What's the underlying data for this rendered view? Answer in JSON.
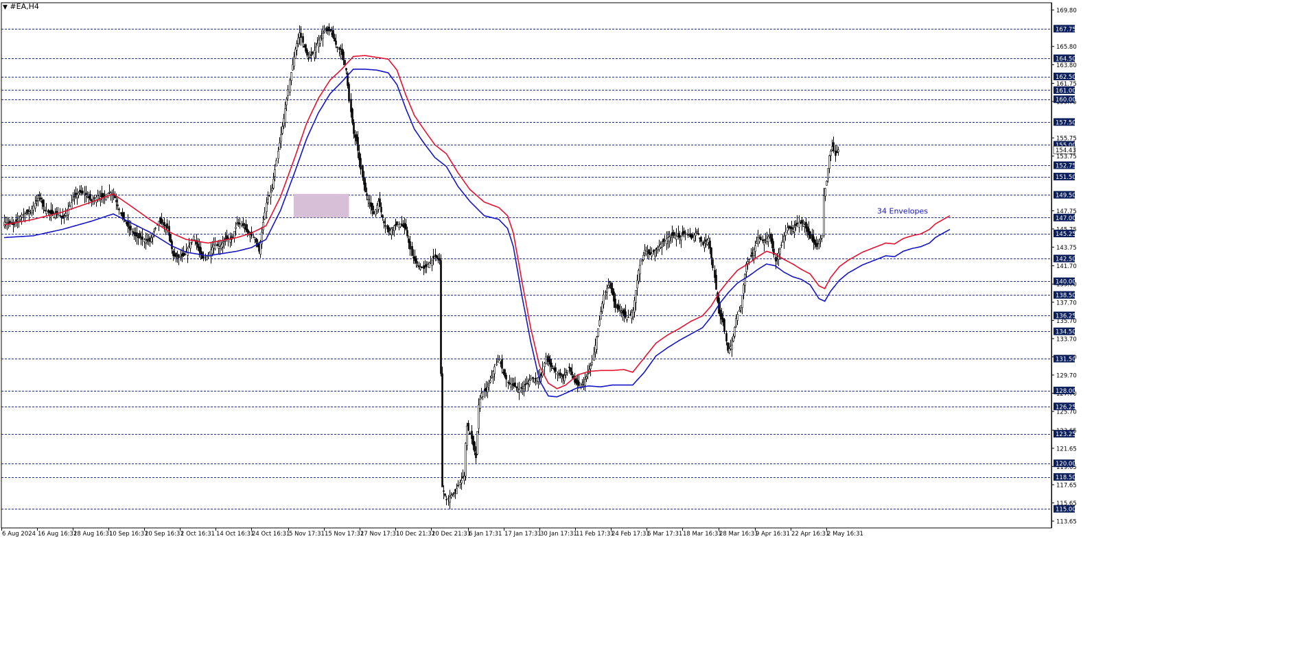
{
  "symbol_title": "#EA,H4",
  "chart_data": {
    "type": "candlestick",
    "symbol": "#EA",
    "timeframe": "H4",
    "indicator_label": "34 Envelopes",
    "ylim": [
      112.9,
      170.6
    ],
    "price_scale_ticks": [
      169.8,
      165.8,
      163.8,
      161.75,
      159.75,
      155.75,
      153.75,
      147.75,
      145.75,
      143.75,
      141.7,
      139.7,
      137.7,
      135.7,
      133.7,
      131.7,
      129.7,
      127.7,
      125.7,
      123.65,
      121.65,
      119.65,
      117.65,
      115.65,
      113.65
    ],
    "x_tick_labels": [
      "6 Aug 2024",
      "16 Aug 16:31",
      "28 Aug 16:31",
      "10 Sep 16:31",
      "20 Sep 16:31",
      "2 Oct 16:31",
      "14 Oct 16:31",
      "24 Oct 16:31",
      "5 Nov 17:31",
      "15 Nov 17:31",
      "27 Nov 17:31",
      "10 Dec 21:31",
      "20 Dec 21:31",
      "6 Jan 17:31",
      "17 Jan 17:31",
      "30 Jan 17:31",
      "11 Feb 17:31",
      "24 Feb 17:31",
      "6 Mar 17:31",
      "18 Mar 16:31",
      "28 Mar 16:31",
      "9 Apr 16:31",
      "22 Apr 16:31",
      "2 May 16:31"
    ],
    "horizontal_levels": [
      "167.75",
      "164.50",
      "162.50",
      "161.00",
      "160.00",
      "157.50",
      "155.00",
      "152.75",
      "151.50",
      "149.50",
      "147.00",
      "145.25",
      "142.50",
      "140.00",
      "138.50",
      "136.25",
      "134.50",
      "131.50",
      "128.00",
      "126.25",
      "123.25",
      "120.00",
      "118.50",
      "115.00"
    ],
    "current_price": "154.43",
    "zone": {
      "from_bar": 199,
      "to_bar": 237,
      "y_low": 147.0,
      "y_high": 149.6
    },
    "close_path": [
      [
        0,
        146.5
      ],
      [
        6,
        146.2
      ],
      [
        12,
        147.3
      ],
      [
        18,
        147.7
      ],
      [
        24,
        149.4
      ],
      [
        28,
        147.8
      ],
      [
        32,
        147.4
      ],
      [
        36,
        147.5
      ],
      [
        40,
        146.9
      ],
      [
        44,
        148.0
      ],
      [
        48,
        149.3
      ],
      [
        52,
        149.8
      ],
      [
        56,
        149.5
      ],
      [
        60,
        148.8
      ],
      [
        64,
        149.4
      ],
      [
        68,
        149.2
      ],
      [
        72,
        149.8
      ],
      [
        75,
        149.6
      ],
      [
        80,
        147.4
      ],
      [
        85,
        146.0
      ],
      [
        90,
        145.0
      ],
      [
        95,
        144.6
      ],
      [
        100,
        144.4
      ],
      [
        106,
        146.6
      ],
      [
        112,
        145.8
      ],
      [
        116,
        142.8
      ],
      [
        120,
        142.6
      ],
      [
        124,
        142.9
      ],
      [
        130,
        144.9
      ],
      [
        136,
        142.5
      ],
      [
        140,
        142.9
      ],
      [
        144,
        144.0
      ],
      [
        148,
        143.8
      ],
      [
        152,
        144.6
      ],
      [
        156,
        144.6
      ],
      [
        160,
        146.4
      ],
      [
        164,
        146.1
      ],
      [
        168,
        145.2
      ],
      [
        172,
        144.8
      ],
      [
        175,
        143.3
      ],
      [
        180,
        148.6
      ],
      [
        184,
        150.2
      ],
      [
        188,
        154.3
      ],
      [
        192,
        157.9
      ],
      [
        196,
        162.1
      ],
      [
        200,
        165.5
      ],
      [
        203,
        167.3
      ],
      [
        206,
        165.7
      ],
      [
        209,
        164.4
      ],
      [
        212,
        165.0
      ],
      [
        216,
        166.5
      ],
      [
        220,
        167.5
      ],
      [
        224,
        167.5
      ],
      [
        228,
        166.0
      ],
      [
        232,
        164.9
      ],
      [
        235,
        163.2
      ],
      [
        237,
        159.8
      ],
      [
        240,
        156.2
      ],
      [
        242,
        155.4
      ],
      [
        245,
        152.3
      ],
      [
        248,
        149.8
      ],
      [
        251,
        148.6
      ],
      [
        254,
        147.4
      ],
      [
        257,
        148.8
      ],
      [
        261,
        146.4
      ],
      [
        264,
        145.4
      ],
      [
        268,
        146.1
      ],
      [
        272,
        146.3
      ],
      [
        276,
        145.7
      ],
      [
        280,
        142.8
      ],
      [
        284,
        141.7
      ],
      [
        288,
        141.4
      ],
      [
        292,
        142.0
      ],
      [
        296,
        142.7
      ],
      [
        299,
        142.3
      ],
      [
        301,
        117.4
      ],
      [
        304,
        116.0
      ],
      [
        307,
        116.5
      ],
      [
        310,
        116.9
      ],
      [
        313,
        117.9
      ],
      [
        316,
        118.6
      ],
      [
        317,
        122.2
      ],
      [
        318,
        124.1
      ],
      [
        321,
        122.7
      ],
      [
        324,
        120.6
      ],
      [
        326,
        126.4
      ],
      [
        328,
        127.7
      ],
      [
        331,
        128.0
      ],
      [
        334,
        129.1
      ],
      [
        337,
        130.6
      ],
      [
        340,
        131.5
      ],
      [
        343,
        129.9
      ],
      [
        346,
        128.9
      ],
      [
        350,
        128.5
      ],
      [
        354,
        128.1
      ],
      [
        358,
        128.6
      ],
      [
        362,
        129.3
      ],
      [
        365,
        129.3
      ],
      [
        369,
        129.6
      ],
      [
        372,
        131.7
      ],
      [
        376,
        130.6
      ],
      [
        380,
        129.9
      ],
      [
        384,
        129.4
      ],
      [
        388,
        130.5
      ],
      [
        392,
        128.9
      ],
      [
        396,
        128.4
      ],
      [
        400,
        129.5
      ],
      [
        404,
        131.1
      ],
      [
        408,
        134.8
      ],
      [
        412,
        138.5
      ],
      [
        416,
        139.9
      ],
      [
        420,
        137.1
      ],
      [
        424,
        136.7
      ],
      [
        428,
        135.8
      ],
      [
        432,
        136.8
      ],
      [
        436,
        141.2
      ],
      [
        440,
        143.4
      ],
      [
        444,
        142.9
      ],
      [
        448,
        143.5
      ],
      [
        452,
        144.2
      ],
      [
        456,
        144.8
      ],
      [
        460,
        145.1
      ],
      [
        464,
        144.8
      ],
      [
        468,
        145.4
      ],
      [
        472,
        144.7
      ],
      [
        476,
        145.5
      ],
      [
        480,
        144.0
      ],
      [
        484,
        144.7
      ],
      [
        488,
        140.4
      ],
      [
        491,
        136.5
      ],
      [
        494,
        135.5
      ],
      [
        497,
        132.4
      ],
      [
        500,
        133.0
      ],
      [
        503,
        135.9
      ],
      [
        506,
        137.3
      ],
      [
        510,
        141.9
      ],
      [
        514,
        143.0
      ],
      [
        518,
        144.8
      ],
      [
        522,
        144.3
      ],
      [
        526,
        145.1
      ],
      [
        530,
        142.2
      ],
      [
        534,
        144.0
      ],
      [
        538,
        145.9
      ],
      [
        542,
        145.7
      ],
      [
        546,
        146.5
      ],
      [
        550,
        146.2
      ],
      [
        554,
        144.7
      ],
      [
        558,
        143.8
      ],
      [
        562,
        145.0
      ],
      [
        563,
        149.4
      ],
      [
        565,
        151.0
      ],
      [
        567,
        153.8
      ],
      [
        569,
        154.8
      ],
      [
        571,
        153.8
      ],
      [
        573,
        154.43
      ]
    ],
    "series": [
      {
        "name": "upper",
        "color": "#e8102e",
        "points": [
          [
            0,
            146.2
          ],
          [
            20,
            146.8
          ],
          [
            40,
            147.6
          ],
          [
            60,
            148.7
          ],
          [
            75,
            149.6
          ],
          [
            85,
            148.5
          ],
          [
            100,
            146.8
          ],
          [
            115,
            145.3
          ],
          [
            125,
            144.6
          ],
          [
            140,
            144.2
          ],
          [
            160,
            144.8
          ],
          [
            170,
            145.3
          ],
          [
            180,
            146.1
          ],
          [
            190,
            149.3
          ],
          [
            200,
            153.7
          ],
          [
            208,
            157.4
          ],
          [
            216,
            160.1
          ],
          [
            224,
            162.1
          ],
          [
            232,
            163.3
          ],
          [
            240,
            164.7
          ],
          [
            248,
            164.8
          ],
          [
            256,
            164.6
          ],
          [
            264,
            164.4
          ],
          [
            270,
            163.2
          ],
          [
            276,
            160.5
          ],
          [
            282,
            158.2
          ],
          [
            288,
            156.8
          ],
          [
            296,
            155.0
          ],
          [
            304,
            154.0
          ],
          [
            312,
            151.9
          ],
          [
            320,
            150.1
          ],
          [
            330,
            148.7
          ],
          [
            340,
            148.1
          ],
          [
            346,
            147.2
          ],
          [
            350,
            145.3
          ],
          [
            356,
            139.9
          ],
          [
            362,
            134.8
          ],
          [
            368,
            130.7
          ],
          [
            374,
            128.8
          ],
          [
            380,
            128.2
          ],
          [
            386,
            128.6
          ],
          [
            394,
            129.7
          ],
          [
            402,
            130.1
          ],
          [
            410,
            130.2
          ],
          [
            418,
            130.2
          ],
          [
            426,
            130.3
          ],
          [
            432,
            130.0
          ],
          [
            440,
            131.6
          ],
          [
            448,
            133.2
          ],
          [
            456,
            134.1
          ],
          [
            464,
            134.8
          ],
          [
            472,
            135.6
          ],
          [
            480,
            136.2
          ],
          [
            486,
            137.3
          ],
          [
            492,
            138.9
          ],
          [
            498,
            140.1
          ],
          [
            504,
            141.2
          ],
          [
            512,
            142.0
          ],
          [
            518,
            142.7
          ],
          [
            524,
            143.3
          ],
          [
            530,
            143.0
          ],
          [
            536,
            142.4
          ],
          [
            542,
            141.9
          ],
          [
            548,
            141.3
          ],
          [
            554,
            140.8
          ],
          [
            560,
            139.5
          ],
          [
            564,
            139.2
          ],
          [
            568,
            140.4
          ],
          [
            574,
            141.6
          ],
          [
            580,
            142.3
          ],
          [
            590,
            143.2
          ],
          [
            598,
            143.7
          ],
          [
            606,
            144.2
          ],
          [
            612,
            144.1
          ],
          [
            618,
            144.7
          ],
          [
            624,
            145.0
          ],
          [
            630,
            145.2
          ],
          [
            636,
            145.7
          ],
          [
            640,
            146.3
          ],
          [
            650,
            147.2
          ]
        ]
      },
      {
        "name": "lower",
        "color": "#1414c8",
        "points": [
          [
            0,
            144.8
          ],
          [
            20,
            145.0
          ],
          [
            40,
            145.7
          ],
          [
            60,
            146.6
          ],
          [
            75,
            147.4
          ],
          [
            85,
            146.6
          ],
          [
            100,
            145.4
          ],
          [
            115,
            143.9
          ],
          [
            125,
            143.2
          ],
          [
            140,
            142.8
          ],
          [
            160,
            143.3
          ],
          [
            170,
            143.7
          ],
          [
            180,
            144.6
          ],
          [
            190,
            147.8
          ],
          [
            200,
            152.1
          ],
          [
            208,
            155.7
          ],
          [
            216,
            158.5
          ],
          [
            224,
            160.6
          ],
          [
            232,
            161.9
          ],
          [
            240,
            163.3
          ],
          [
            248,
            163.3
          ],
          [
            256,
            163.2
          ],
          [
            264,
            162.9
          ],
          [
            270,
            161.6
          ],
          [
            276,
            159.0
          ],
          [
            282,
            156.7
          ],
          [
            288,
            155.3
          ],
          [
            296,
            153.6
          ],
          [
            304,
            152.6
          ],
          [
            312,
            150.4
          ],
          [
            320,
            148.8
          ],
          [
            330,
            147.2
          ],
          [
            340,
            146.8
          ],
          [
            346,
            145.8
          ],
          [
            350,
            143.8
          ],
          [
            356,
            138.3
          ],
          [
            362,
            133.3
          ],
          [
            368,
            129.1
          ],
          [
            374,
            127.4
          ],
          [
            380,
            127.3
          ],
          [
            386,
            127.7
          ],
          [
            394,
            128.3
          ],
          [
            402,
            128.5
          ],
          [
            410,
            128.4
          ],
          [
            418,
            128.6
          ],
          [
            426,
            128.6
          ],
          [
            432,
            128.6
          ],
          [
            440,
            130.0
          ],
          [
            448,
            131.8
          ],
          [
            456,
            132.7
          ],
          [
            464,
            133.5
          ],
          [
            472,
            134.2
          ],
          [
            480,
            134.9
          ],
          [
            486,
            136.1
          ],
          [
            492,
            137.6
          ],
          [
            498,
            138.8
          ],
          [
            504,
            139.8
          ],
          [
            512,
            140.6
          ],
          [
            518,
            141.3
          ],
          [
            524,
            141.9
          ],
          [
            530,
            141.7
          ],
          [
            536,
            141.0
          ],
          [
            542,
            140.5
          ],
          [
            548,
            140.2
          ],
          [
            554,
            139.6
          ],
          [
            560,
            138.1
          ],
          [
            564,
            137.8
          ],
          [
            568,
            138.9
          ],
          [
            574,
            140.1
          ],
          [
            580,
            140.9
          ],
          [
            590,
            141.8
          ],
          [
            598,
            142.3
          ],
          [
            606,
            142.8
          ],
          [
            612,
            142.7
          ],
          [
            618,
            143.3
          ],
          [
            624,
            143.6
          ],
          [
            630,
            143.8
          ],
          [
            636,
            144.2
          ],
          [
            640,
            144.8
          ],
          [
            650,
            145.7
          ]
        ]
      }
    ]
  }
}
